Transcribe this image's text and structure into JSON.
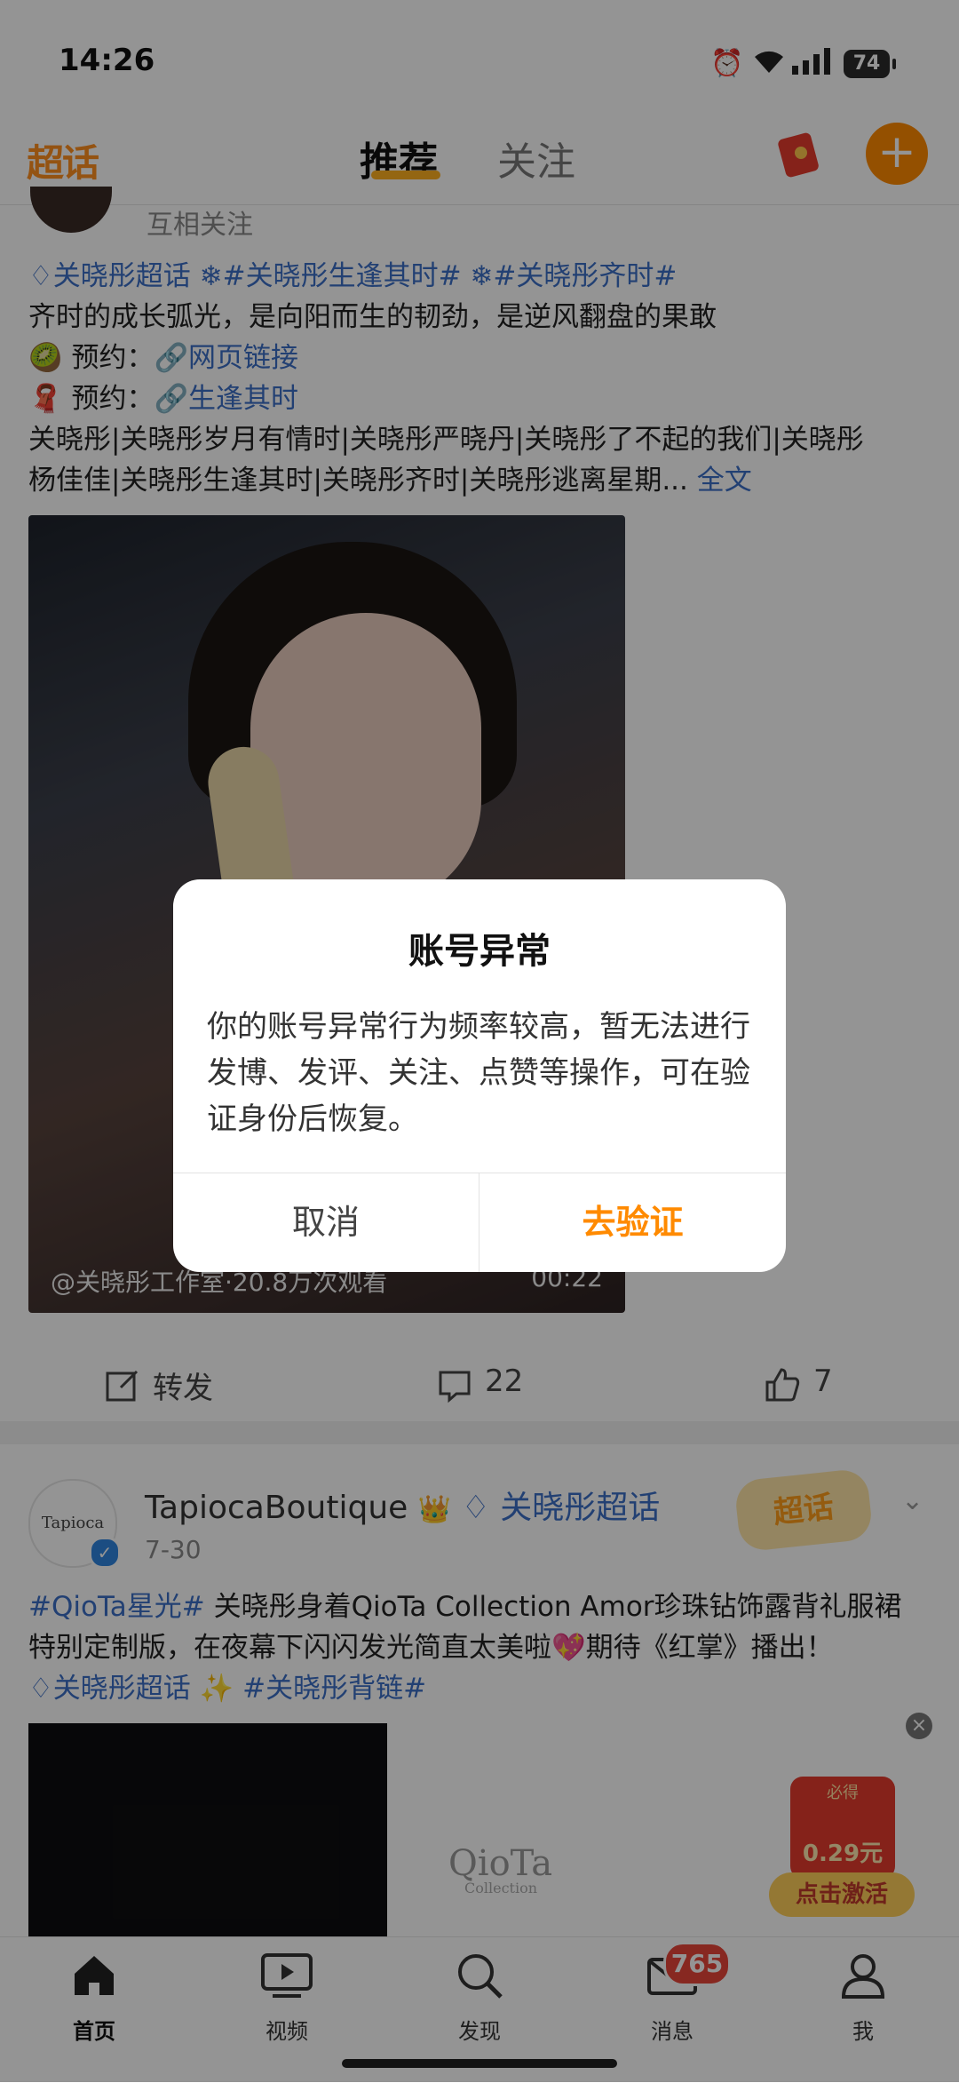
{
  "status_bar": {
    "time": "14:26",
    "battery": "74"
  },
  "top_nav": {
    "logo": "超话",
    "tabs": [
      "推荐",
      "关注"
    ]
  },
  "post1": {
    "follow_status": "互相关注",
    "lines": [
      [
        "♢关晓彤超话",
        " ❄#关晓彤生逢其时#",
        " ❄#关晓彤齐时#"
      ],
      "齐时的成长弧光，是向阳而生的韧劲，是逆风翻盘的果敢",
      [
        "🥝 预约：",
        "🔗网页链接"
      ],
      [
        "🧣 预约：",
        "🔗生逢其时"
      ],
      "关晓彤|关晓彤岁月有情时|关晓彤严晓丹|关晓彤了不起的我们|关晓彤",
      [
        "杨佳佳|关晓彤生逢其时|关晓彤齐时|关晓彤逃离星期...",
        " 全文"
      ]
    ],
    "video_caption": "@关晓彤工作室·20.8万次观看",
    "video_duration": "00:22",
    "actions": {
      "repost": "转发",
      "comments": "22",
      "likes": "7"
    }
  },
  "post2": {
    "avatar_text": "Tapioca",
    "username": "TapiocaBoutique",
    "topic": "关晓彤超话",
    "date": "7-30",
    "badge": "超话",
    "lines": [
      [
        "#QioTa星光#",
        " 关晓彤身着QioTa Collection Amor珍珠钻饰露背礼服裙"
      ],
      "特别定制版，在夜幕下闪闪发光简直太美啦💖期待《红掌》播出！",
      [
        "♢关晓彤超话",
        " ✨ ",
        "#关晓彤背链#"
      ]
    ],
    "brand": "QioTa",
    "brand_sub": "Collection"
  },
  "ad": {
    "top": "必得",
    "value": "0.29元",
    "button": "点击激活"
  },
  "bottom_nav": {
    "items": [
      "首页",
      "视频",
      "发现",
      "消息",
      "我"
    ],
    "message_badge": "765"
  },
  "dialog": {
    "title": "账号异常",
    "body": "你的账号异常行为频率较高，暂无法进行发博、发评、关注、点赞等操作，可在验证身份后恢复。",
    "cancel": "取消",
    "confirm": "去验证"
  },
  "colors": {
    "accent": "#ff8a00",
    "link": "#3b6ec6",
    "badge": "#e8463a"
  }
}
